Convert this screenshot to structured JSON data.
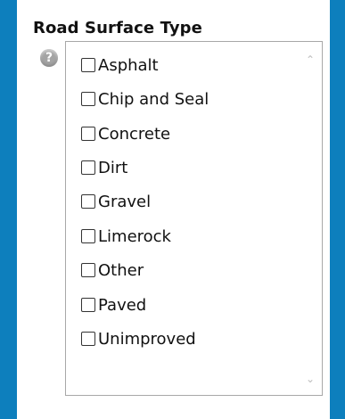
{
  "field": {
    "title": "Road Surface Type",
    "help_icon": "help-icon",
    "help_glyph": "?"
  },
  "options": [
    {
      "label": "Asphalt",
      "checked": false
    },
    {
      "label": "Chip and Seal",
      "checked": false
    },
    {
      "label": "Concrete",
      "checked": false
    },
    {
      "label": "Dirt",
      "checked": false
    },
    {
      "label": "Gravel",
      "checked": false
    },
    {
      "label": "Limerock",
      "checked": false
    },
    {
      "label": "Other",
      "checked": false
    },
    {
      "label": "Paved",
      "checked": false
    },
    {
      "label": "Unimproved",
      "checked": false
    }
  ],
  "scrollbar": {
    "up_icon": "chevron-up-icon",
    "down_icon": "chevron-down-icon",
    "up_glyph": "⌃",
    "down_glyph": "⌄"
  },
  "colors": {
    "background": "#0d7fbd",
    "panel": "#ffffff",
    "text": "#111111",
    "border": "#a8a8a8"
  }
}
